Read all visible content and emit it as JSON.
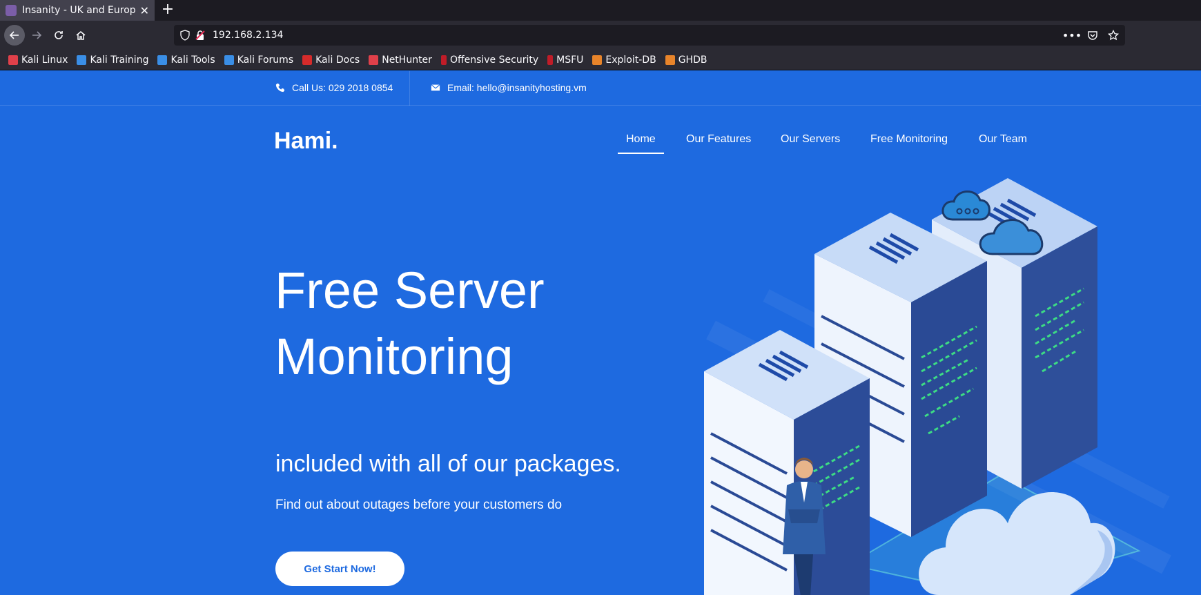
{
  "browser": {
    "tab_title": "Insanity - UK and European Hosting",
    "url": "192.168.2.134",
    "bookmarks": [
      {
        "label": "Kali Linux",
        "color": "#e0404a"
      },
      {
        "label": "Kali Training",
        "color": "#3a8ee6"
      },
      {
        "label": "Kali Tools",
        "color": "#3a8ee6"
      },
      {
        "label": "Kali Forums",
        "color": "#3a8ee6"
      },
      {
        "label": "Kali Docs",
        "color": "#d62b2b"
      },
      {
        "label": "NetHunter",
        "color": "#e0404a"
      },
      {
        "label": "Offensive Security",
        "color": "#c01c28"
      },
      {
        "label": "MSFU",
        "color": "#c01c28"
      },
      {
        "label": "Exploit-DB",
        "color": "#e8842a"
      },
      {
        "label": "GHDB",
        "color": "#e8842a"
      }
    ]
  },
  "topbar": {
    "phone": "Call Us: 029 2018 0854",
    "email": "Email: hello@insanityhosting.vm"
  },
  "header": {
    "logo": "Hami.",
    "nav": {
      "home": "Home",
      "features": "Our Features",
      "servers": "Our Servers",
      "monitoring": "Free Monitoring",
      "team": "Our Team"
    }
  },
  "hero": {
    "title_line1": "Free Server",
    "title_line2": "Monitoring",
    "subtitle": "included with all of our packages.",
    "text": "Find out about outages before your customers do",
    "button": "Get Start Now!"
  },
  "colors": {
    "page_bg": "#1e6ae0",
    "accent": "#1e6ae0"
  }
}
